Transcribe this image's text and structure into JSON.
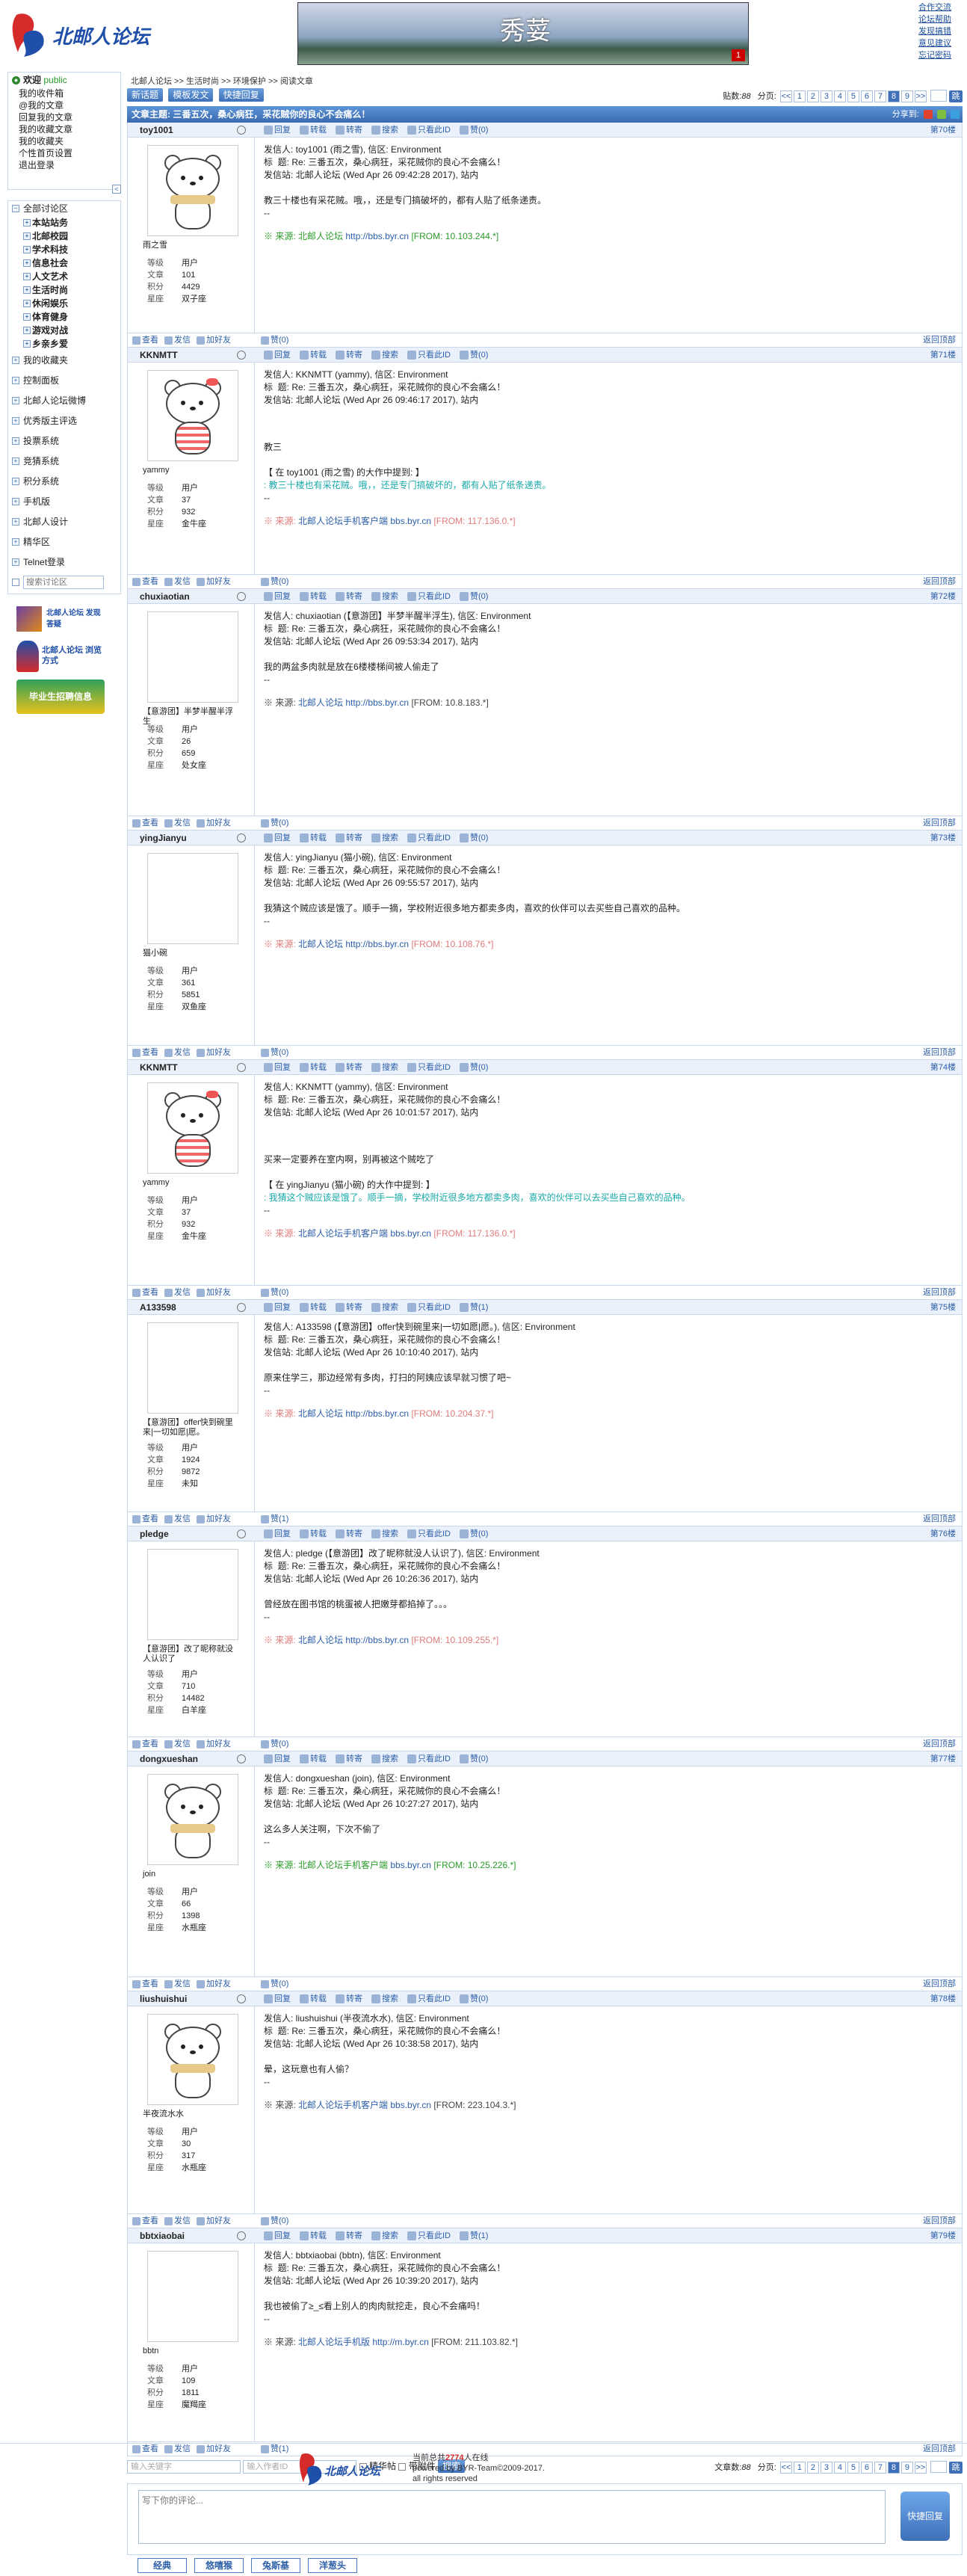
{
  "header": {
    "logo_text": "北邮人论坛",
    "banner_title": "秀荽",
    "banner_badge": "1",
    "top_links": [
      "合作交流",
      "论坛帮助",
      "发现搞错",
      "意见建议",
      "忘记密码"
    ]
  },
  "sidebar": {
    "welcome": "欢迎",
    "welcome_user": "public",
    "user_links": [
      "我的收件箱",
      "@我的文章",
      "回复我的文章",
      "我的收藏文章",
      "我的收藏夹",
      "个性首页设置",
      "退出登录"
    ],
    "all_boards": "全部讨论区",
    "boards": [
      "本站站务",
      "北邮校园",
      "学术科技",
      "信息社会",
      "人文艺术",
      "生活时尚",
      "休闲娱乐",
      "体育健身",
      "游戏对战",
      "乡亲乡爱"
    ],
    "menu": [
      "我的收藏夹",
      "控制面板",
      "北邮人论坛微博",
      "优秀版主评选",
      "投票系统",
      "竞猜系统",
      "积分系统",
      "手机版",
      "北邮人设计",
      "精华区",
      "Telnet登录"
    ],
    "search_placeholder": "搜索讨论区",
    "ad1": "北邮人论坛 发现答疑",
    "ad2": "北邮人论坛 浏览方式",
    "ad3": "毕业生招聘信息"
  },
  "main": {
    "breadcrumb": "北邮人论坛 >> 生活时尚 >> 环境保护 >> 阅读文章",
    "btn_new": "新话题",
    "btn_template": "模板发文",
    "btn_quick": "快捷回复",
    "post_count_label": "贴数:",
    "post_count": "88",
    "page_label": "分页:",
    "pages": [
      "<<",
      "1",
      "2",
      "3",
      "4",
      "5",
      "6",
      "7",
      "8",
      "9",
      ">>"
    ],
    "current_page": "8",
    "go": "跳",
    "topic": "文章主题: 三番五次，桑心病狂，采花贼你的良心不会痛么！",
    "share": "分享到:"
  },
  "actions": [
    "回复",
    "转载",
    "转寄",
    "搜索",
    "只看此ID",
    "赞"
  ],
  "foot_actions": [
    "查看",
    "发信",
    "加好友"
  ],
  "back_top": "返回顶部",
  "stat_labels": [
    "等级",
    "文章",
    "积分",
    "星座"
  ],
  "posts": [
    {
      "user": "toy1001",
      "nick": "雨之雪",
      "level": "用户",
      "articles": "101",
      "score": "4429",
      "sign": "双子座",
      "bear": "scarf",
      "likes": "(0)",
      "floor": "第70楼",
      "lines": [
        "发信人: toy1001 (雨之雪), 信区: Environment",
        "标  题: Re: 三番五次，桑心病狂，采花贼你的良心不会痛么！",
        "发信站: 北邮人论坛 (Wed Apr 26 09:42:28 2017), 站内",
        "",
        "教三十楼也有采花贼。哦，，还是专门搞破坏的，都有人贴了纸条递责。",
        "--"
      ],
      "src_label": "※ 来源:",
      "src_name": "北邮人论坛",
      "src_url": "http://bbs.byr.cn",
      "src_ip": "[FROM: 10.103.244.*]",
      "src_class": "ip-green",
      "quote": ""
    },
    {
      "user": "KKNMTT",
      "nick": "yammy",
      "level": "用户",
      "articles": "37",
      "score": "932",
      "sign": "金牛座",
      "bear": "stripe",
      "likes": "(0)",
      "floor": "第71楼",
      "lines": [
        "发信人: KKNMTT (yammy), 信区: Environment",
        "标  题: Re: 三番五次，桑心病狂，采花贼你的良心不会痛么！",
        "发信站: 北邮人论坛 (Wed Apr 26 09:46:17 2017), 站内",
        "",
        "",
        "教三",
        "",
        "【 在 toy1001 (雨之雪) 的大作中提到: 】"
      ],
      "quote": ": 教三十楼也有采花贼。哦，，还是专门搞破坏的，都有人贴了纸条递责。",
      "src_label": "※ 来源:",
      "src_name": "北邮人论坛手机客户端",
      "src_url": "bbs.byr.cn",
      "src_ip": "[FROM: 117.136.0.*]",
      "src_class": "ip-pink"
    },
    {
      "user": "chuxiaotian",
      "nick": "【意游团】半梦半醒半浮生",
      "level": "用户",
      "articles": "26",
      "score": "659",
      "sign": "处女座",
      "bear": "none",
      "likes": "(0)",
      "floor": "第72楼",
      "lines": [
        "发信人: chuxiaotian (【意游团】半梦半醒半浮生), 信区: Environment",
        "标  题: Re: 三番五次，桑心病狂，采花贼你的良心不会痛么！",
        "发信站: 北邮人论坛 (Wed Apr 26 09:53:34 2017), 站内",
        "",
        "我的两盆多肉就是放在6楼楼梯间被人偷走了",
        "--"
      ],
      "src_label": "※ 来源:",
      "src_name": "北邮人论坛",
      "src_url": "http://bbs.byr.cn",
      "src_ip": "[FROM: 10.8.183.*]",
      "src_class": "ip-gray",
      "quote": ""
    },
    {
      "user": "yingJianyu",
      "nick": "猫小碗",
      "level": "用户",
      "articles": "361",
      "score": "5851",
      "sign": "双鱼座",
      "bear": "none",
      "likes": "(0)",
      "floor": "第73楼",
      "lines": [
        "发信人: yingJianyu (猫小碗), 信区: Environment",
        "标  题: Re: 三番五次，桑心病狂，采花贼你的良心不会痛么！",
        "发信站: 北邮人论坛 (Wed Apr 26 09:55:57 2017), 站内",
        "",
        "我猜这个贼应该是饿了。顺手一摘，学校附近很多地方都卖多肉，喜欢的伙伴可以去买些自己喜欢的品种。",
        "--"
      ],
      "src_label": "※ 来源:",
      "src_name": "北邮人论坛",
      "src_url": "http://bbs.byr.cn",
      "src_ip": "[FROM: 10.108.76.*]",
      "src_class": "ip-pink",
      "quote": ""
    },
    {
      "user": "KKNMTT",
      "nick": "yammy",
      "level": "用户",
      "articles": "37",
      "score": "932",
      "sign": "金牛座",
      "bear": "stripe",
      "likes": "(0)",
      "floor": "第74楼",
      "lines": [
        "发信人: KKNMTT (yammy), 信区: Environment",
        "标  题: Re: 三番五次，桑心病狂，采花贼你的良心不会痛么！",
        "发信站: 北邮人论坛 (Wed Apr 26 10:01:57 2017), 站内",
        "",
        "",
        "买来一定要养在室内啊，别再被这个贼吃了",
        "",
        "【 在 yingJianyu (猫小碗) 的大作中提到: 】"
      ],
      "quote": ": 我猜这个贼应该是饿了。顺手一摘，学校附近很多地方都卖多肉，喜欢的伙伴可以去买些自己喜欢的品种。",
      "src_label": "※ 来源:",
      "src_name": "北邮人论坛手机客户端",
      "src_url": "bbs.byr.cn",
      "src_ip": "[FROM: 117.136.0.*]",
      "src_class": "ip-pink"
    },
    {
      "user": "A133598",
      "nick": "【意游团】offer快到碗里来|一切如愿|愿。",
      "level": "用户",
      "articles": "1924",
      "score": "9872",
      "sign": "未知",
      "bear": "none",
      "likes": "(1)",
      "floor": "第75楼",
      "lines": [
        "发信人: A133598 (【意游团】offer快到碗里来|一切如愿|愿。), 信区: Environment",
        "标  题: Re: 三番五次，桑心病狂，采花贼你的良心不会痛么！",
        "发信站: 北邮人论坛 (Wed Apr 26 10:10:40 2017), 站内",
        "",
        "原来住学三，那边经常有多肉，打扫的阿姨应该早就习惯了吧~",
        "--"
      ],
      "src_label": "※ 来源:",
      "src_name": "北邮人论坛",
      "src_url": "http://bbs.byr.cn",
      "src_ip": "[FROM: 10.204.37.*]",
      "src_class": "ip-pink",
      "quote": ""
    },
    {
      "user": "pledge",
      "nick": "【意游团】改了昵称就没人认识了",
      "level": "用户",
      "articles": "710",
      "score": "14482",
      "sign": "白羊座",
      "bear": "none",
      "likes": "(0)",
      "floor": "第76楼",
      "lines": [
        "发信人: pledge (【意游团】改了昵称就没人认识了), 信区: Environment",
        "标  题: Re: 三番五次，桑心病狂，采花贼你的良心不会痛么！",
        "发信站: 北邮人论坛 (Wed Apr 26 10:26:36 2017), 站内",
        "",
        "曾经放在图书馆的桃蛋被人把嫩芽都掐掉了。。。",
        "--"
      ],
      "src_label": "※ 来源:",
      "src_name": "北邮人论坛",
      "src_url": "http://bbs.byr.cn",
      "src_ip": "[FROM: 10.109.255.*]",
      "src_class": "ip-pink",
      "quote": ""
    },
    {
      "user": "dongxueshan",
      "nick": "join",
      "level": "用户",
      "articles": "66",
      "score": "1398",
      "sign": "水瓶座",
      "bear": "scarf",
      "likes": "(0)",
      "floor": "第77楼",
      "lines": [
        "发信人: dongxueshan (join), 信区: Environment",
        "标  题: Re: 三番五次，桑心病狂，采花贼你的良心不会痛么！",
        "发信站: 北邮人论坛 (Wed Apr 26 10:27:27 2017), 站内",
        "",
        "这么多人关注啊，下次不偷了",
        "--"
      ],
      "src_label": "※ 来源:",
      "src_name": "北邮人论坛手机客户端",
      "src_url": "bbs.byr.cn",
      "src_ip": "[FROM: 10.25.226.*]",
      "src_class": "ip-green",
      "quote": ""
    },
    {
      "user": "liushuishui",
      "nick": "半夜流水水",
      "level": "用户",
      "articles": "30",
      "score": "317",
      "sign": "水瓶座",
      "bear": "scarf",
      "likes": "(0)",
      "floor": "第78楼",
      "lines": [
        "发信人: liushuishui (半夜流水水), 信区: Environment",
        "标  题: Re: 三番五次，桑心病狂，采花贼你的良心不会痛么！",
        "发信站: 北邮人论坛 (Wed Apr 26 10:38:58 2017), 站内",
        "",
        "晕，这玩意也有人偷？",
        "--"
      ],
      "src_label": "※ 来源:",
      "src_name": "北邮人论坛手机客户端",
      "src_url": "bbs.byr.cn",
      "src_ip": "[FROM: 223.104.3.*]",
      "src_class": "ip-gray",
      "quote": ""
    },
    {
      "user": "bbtxiaobai",
      "nick": "bbtn",
      "level": "用户",
      "articles": "109",
      "score": "1811",
      "sign": "魔羯座",
      "bear": "none",
      "likes": "(1)",
      "floor": "第79楼",
      "lines": [
        "发信人: bbtxiaobai (bbtn), 信区: Environment",
        "标  题: Re: 三番五次，桑心病狂，采花贼你的良心不会痛么！",
        "发信站: 北邮人论坛 (Wed Apr 26 10:39:20 2017), 站内",
        "",
        "我也被偷了≥_≤看上别人的肉肉就挖走，良心不会痛吗！",
        "--"
      ],
      "src_label": "※ 来源:",
      "src_name": "北邮人论坛手机版",
      "src_url": "http://m.byr.cn",
      "src_ip": "[FROM: 211.103.82.*]",
      "src_class": "ip-gray",
      "quote": ""
    }
  ],
  "bottom": {
    "kw_placeholder": "输入关键字",
    "author_placeholder": "输入作者ID",
    "chk_good": "精华帖",
    "chk_attach": "带附件",
    "search_btn": "搜索",
    "post_count_label": "文章数:",
    "post_count": "88",
    "reply_placeholder": "写下你的评论...",
    "quick_reply": "快捷回复",
    "emoji_tabs": [
      "经典",
      "悠嘻猴",
      "兔斯基",
      "洋葱头"
    ]
  },
  "footer": {
    "online_prefix": "当前总共",
    "online_count": "2774",
    "online_suffix": "人在线",
    "powered": "powered by BYR-Team©2009-2017.",
    "rights": "all rights reserved"
  }
}
